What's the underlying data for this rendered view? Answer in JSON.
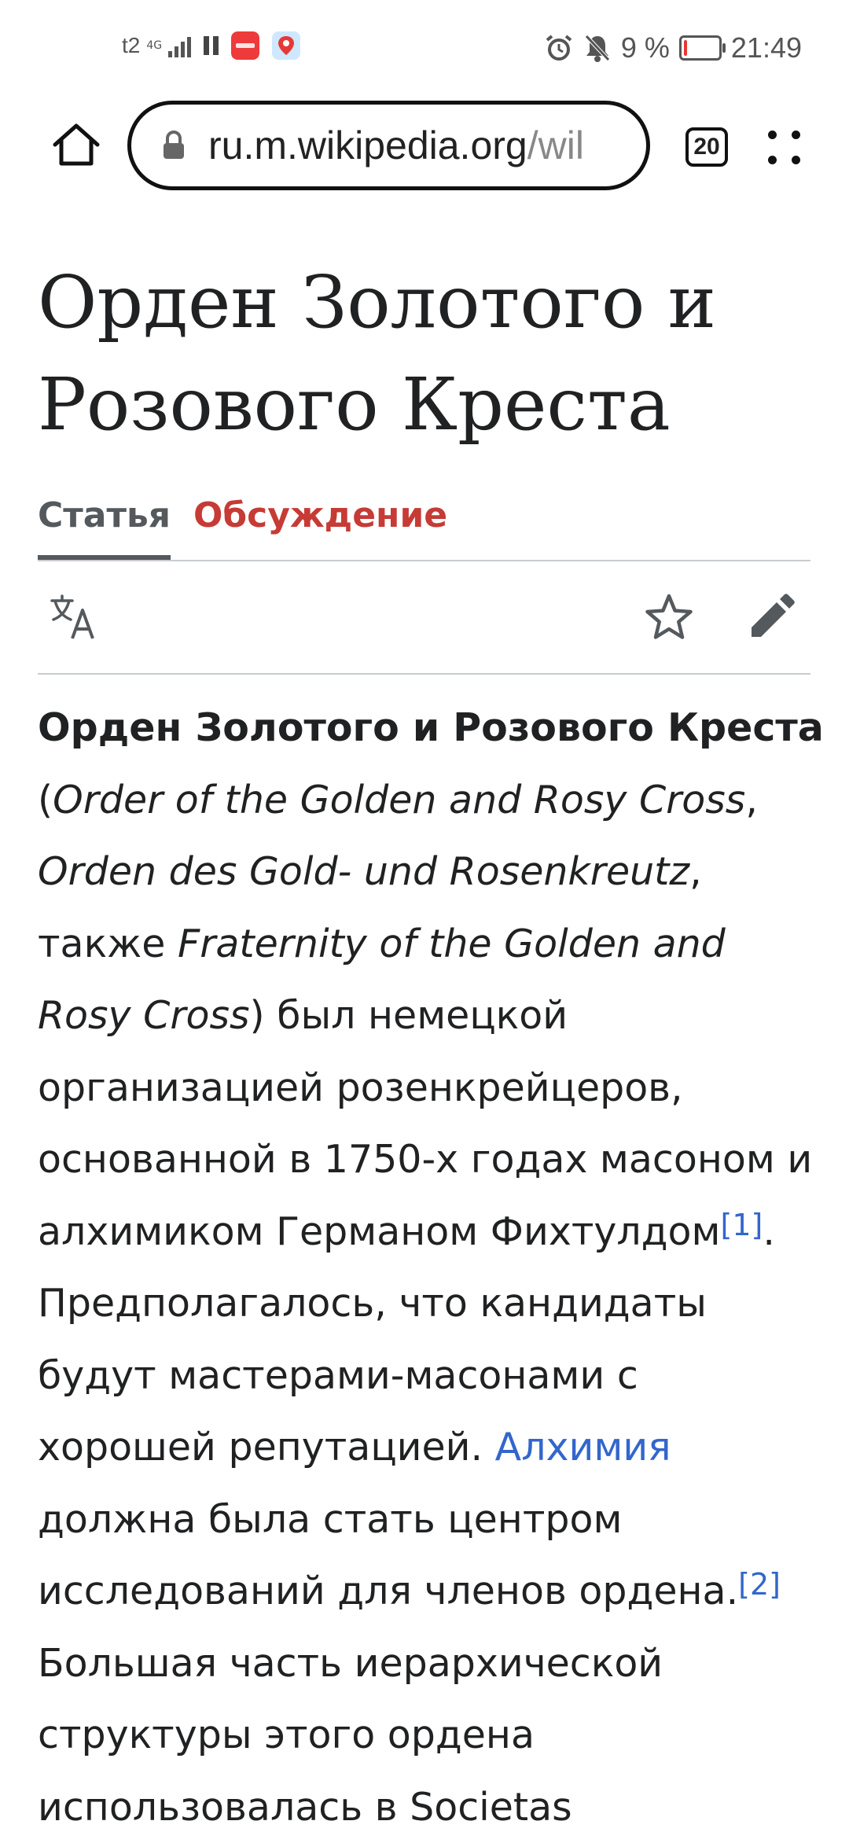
{
  "status_bar": {
    "carrier": "t2",
    "network": "4G",
    "battery": "9 %",
    "battery_level": 0.09,
    "time": "21:49",
    "colors": {
      "battery_low": "#e53935",
      "huawei_app": "#ee3a3a"
    }
  },
  "browser": {
    "url_main": "ru.m.wikipedia.org",
    "url_rest": "/wil",
    "tabs_count": "20",
    "icons": [
      "home-icon",
      "lock-icon",
      "tabs-icon",
      "menu-icon"
    ]
  },
  "article": {
    "title": "Орден Золотого и Розового Креста",
    "tabs": [
      {
        "label": "Статья",
        "active": true
      },
      {
        "label": "Обсуждение",
        "active": false
      }
    ],
    "actions": [
      "language-icon",
      "star-icon",
      "edit-icon"
    ],
    "body": {
      "bold_name": "Орден Золотого и Розового Креста",
      "open_paren": " (",
      "italic_1": "Order of the Golden and Rosy Cross",
      "comma_1": ", ",
      "italic_2": "Orden des Gold- und Rosenkreutz",
      "also": ", также ",
      "italic_3": "Fraternity of the Golden and Rosy Cross",
      "text_1": ") был немецкой организацией розенкрейцеров, основанной в 1750-х годах масоном и алхимиком Германом Фихтулдом",
      "ref_1": "[1]",
      "text_2": ". Предполагалось, что кандидаты будут мастерами-масонами с хорошей репутацией. ",
      "link_alchemy": "Алхимия",
      "text_3": " должна была стать центром исследований для членов ордена.",
      "ref_2": "[2]",
      "text_4": " Большая часть иерархической структуры этого ордена использовалась в Societas"
    },
    "colors": {
      "link": "#3366cc",
      "talk_tab": "#c63b35",
      "active_tab": "#54595d"
    }
  }
}
